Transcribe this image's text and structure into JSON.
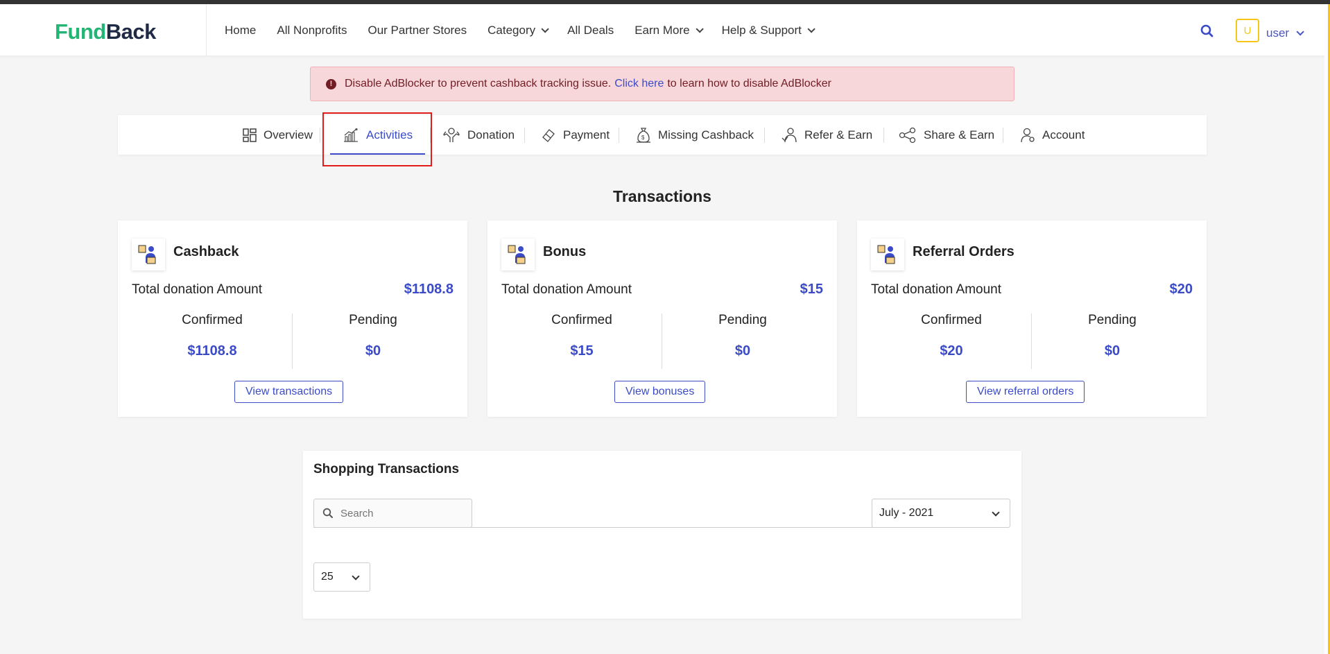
{
  "header": {
    "logo_part1": "Fund",
    "logo_part2": "Back",
    "nav": [
      {
        "label": "Home"
      },
      {
        "label": "All Nonprofits"
      },
      {
        "label": "Our Partner Stores"
      },
      {
        "label": "Category"
      },
      {
        "label": "All Deals"
      },
      {
        "label": "Earn More"
      },
      {
        "label": "Help & Support"
      }
    ],
    "avatar_initial": "U",
    "user_label": "user"
  },
  "alert": {
    "text_before": "Disable AdBlocker to prevent cashback tracking issue.",
    "link": "Click here",
    "text_after": "to learn how to disable AdBlocker"
  },
  "tabs": [
    {
      "label": "Overview"
    },
    {
      "label": "Activities"
    },
    {
      "label": "Donation"
    },
    {
      "label": "Payment"
    },
    {
      "label": "Missing Cashback"
    },
    {
      "label": "Refer & Earn"
    },
    {
      "label": "Share & Earn"
    },
    {
      "label": "Account"
    }
  ],
  "active_tab": "Activities",
  "section_title": "Transactions",
  "cards": [
    {
      "title": "Cashback",
      "total_label": "Total donation Amount",
      "total": "$1108.8",
      "confirmed_label": "Confirmed",
      "confirmed": "$1108.8",
      "pending_label": "Pending",
      "pending": "$0",
      "button": "View transactions"
    },
    {
      "title": "Bonus",
      "total_label": "Total donation Amount",
      "total": "$15",
      "confirmed_label": "Confirmed",
      "confirmed": "$15",
      "pending_label": "Pending",
      "pending": "$0",
      "button": "View bonuses"
    },
    {
      "title": "Referral Orders",
      "total_label": "Total donation Amount",
      "total": "$20",
      "confirmed_label": "Confirmed",
      "confirmed": "$20",
      "pending_label": "Pending",
      "pending": "$0",
      "button": "View referral orders"
    }
  ],
  "shopping": {
    "title": "Shopping Transactions",
    "search_placeholder": "Search",
    "month": "July - 2021",
    "page_size": "25"
  },
  "colors": {
    "brand_green": "#22b573",
    "accent_blue": "#3b4bc8",
    "highlight_red": "#e21b1b",
    "avatar_yellow": "#f5c518"
  }
}
